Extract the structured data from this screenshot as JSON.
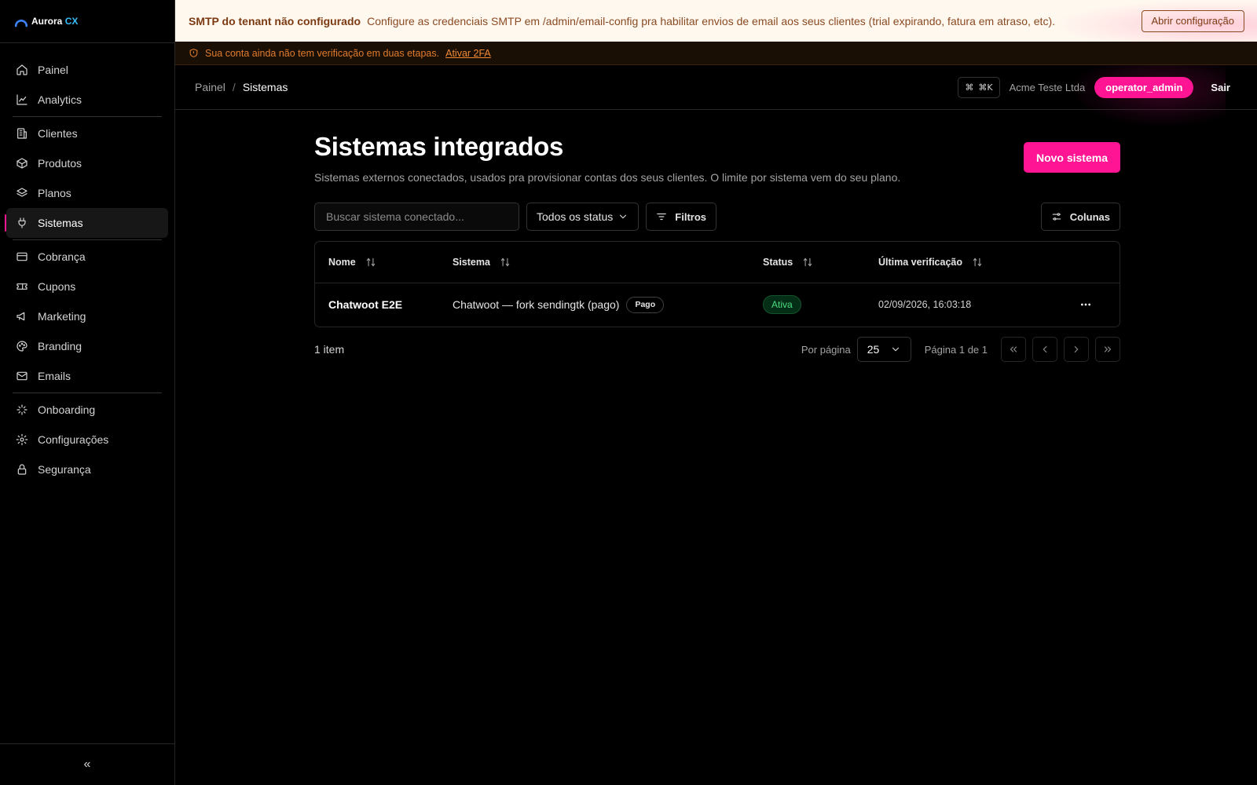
{
  "brand": {
    "name": "Aurora",
    "suffix": "CX"
  },
  "sidebar": {
    "groups": [
      [
        {
          "label": "Painel",
          "icon": "home-icon"
        },
        {
          "label": "Analytics",
          "icon": "line-chart-icon"
        }
      ],
      [
        {
          "label": "Clientes",
          "icon": "building-icon"
        },
        {
          "label": "Produtos",
          "icon": "package-icon"
        },
        {
          "label": "Planos",
          "icon": "layers-icon"
        },
        {
          "label": "Sistemas",
          "icon": "plug-icon",
          "active": true
        }
      ],
      [
        {
          "label": "Cobrança",
          "icon": "credit-card-icon"
        },
        {
          "label": "Cupons",
          "icon": "ticket-icon"
        },
        {
          "label": "Marketing",
          "icon": "megaphone-icon"
        },
        {
          "label": "Branding",
          "icon": "palette-icon"
        },
        {
          "label": "Emails",
          "icon": "mail-icon"
        }
      ],
      [
        {
          "label": "Onboarding",
          "icon": "sparkles-icon"
        },
        {
          "label": "Configurações",
          "icon": "gear-icon"
        },
        {
          "label": "Segurança",
          "icon": "lock-icon"
        }
      ]
    ],
    "collapse_label": "«"
  },
  "smtp_banner": {
    "title": "SMTP do tenant não configurado",
    "message": "Configure as credenciais SMTP em /admin/email-config pra habilitar envios de email aos seus clientes (trial expirando, fatura em atraso, etc).",
    "button": "Abrir configuração"
  },
  "twofa_banner": {
    "message": "Sua conta ainda não tem verificação em duas etapas.",
    "link": "Ativar 2FA"
  },
  "topbar": {
    "breadcrumb": [
      "Painel",
      "Sistemas"
    ],
    "separator": "/",
    "shortcut_symbol": "⌘",
    "shortcut_keys": "⌘K",
    "tenant": "Acme Teste Ltda",
    "role": "operator_admin",
    "logout": "Sair"
  },
  "page": {
    "title": "Sistemas integrados",
    "subtitle": "Sistemas externos conectados, usados pra provisionar contas dos seus clientes. O limite por sistema vem do seu plano.",
    "new_button": "Novo sistema"
  },
  "toolbar": {
    "search_placeholder": "Buscar sistema conectado...",
    "status_select": "Todos os status",
    "filters_label": "Filtros",
    "columns_label": "Colunas"
  },
  "table": {
    "columns": [
      "Nome",
      "Sistema",
      "Status",
      "Última verificação"
    ],
    "rows": [
      {
        "nome": "Chatwoot E2E",
        "sistema": "Chatwoot — fork sendingtk (pago)",
        "sistema_badge": "Pago",
        "status": "Ativa",
        "ultima_verificacao": "02/09/2026, 16:03:18"
      }
    ]
  },
  "pagination": {
    "count_label": "1 item",
    "per_page_label": "Por página",
    "per_page_value": "25",
    "page_label": "Página 1 de 1"
  },
  "colors": {
    "accent": "#ff1493",
    "status_active": "#4ade80",
    "banner_bg": "#fff8ef",
    "warning": "#e07b2b"
  }
}
